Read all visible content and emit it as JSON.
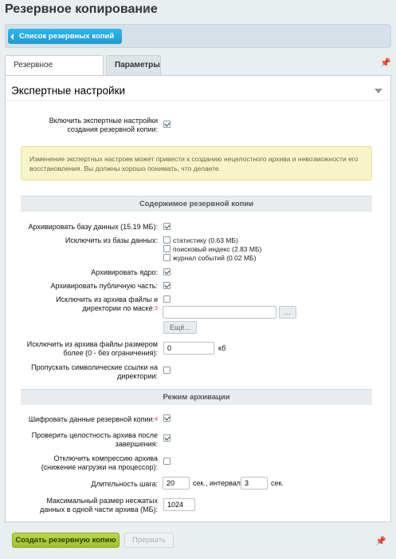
{
  "page": {
    "title": "Резервное копирование",
    "star_icon": "star-icon"
  },
  "toolbar": {
    "list_button": "Список резервных копий"
  },
  "tabs": [
    {
      "label": "Резервное копирование",
      "active": false
    },
    {
      "label": "Параметры",
      "active": true
    }
  ],
  "panel": {
    "title": "Экспертные настройки"
  },
  "expert": {
    "enable_label": "Включить экспертные настройки создания резервной копии:",
    "enable_checked": true,
    "warning": "Изменение экспертных настроек может привести к созданию нецелостного архива и невозможности его восстановления. Вы должны хорошо понимать, что делаете."
  },
  "content_section": {
    "title": "Содержимое резервной копии",
    "archive_db_label": "Архивировать базу данных (15.19 МБ):",
    "archive_db_checked": true,
    "exclude_db_label": "Исключить из базы данных:",
    "exclude_db_options": [
      {
        "label": "статистику (0.63 МБ)",
        "checked": false
      },
      {
        "label": "поисковый индекс (2.83 МБ)",
        "checked": false
      },
      {
        "label": "журнал событий (0.02 МБ)",
        "checked": false
      }
    ],
    "archive_core_label": "Архивировать ядро:",
    "archive_core_checked": true,
    "archive_public_label": "Архивировать публичную часть:",
    "archive_public_checked": true,
    "exclude_mask_label": "Исключить из архива файлы и директории по маске:",
    "exclude_mask_note": "3",
    "exclude_mask_checked": false,
    "mask_value": "",
    "browse_button": "...",
    "more_button": "Ещё...",
    "exclude_size_label": "Исключить из архива файлы размером более (0 - без ограничения):",
    "exclude_size_value": "0",
    "exclude_size_unit": "кб",
    "skip_symlinks_label": "Пропускать символические ссылки на директории:",
    "skip_symlinks_checked": false
  },
  "archive_mode": {
    "title": "Режим архивации",
    "encrypt_label": "Шифровать данные резервной копии:",
    "encrypt_note": "4",
    "encrypt_checked": true,
    "verify_label": "Проверить целостность архива после завершения:",
    "verify_checked": true,
    "no_compress_label": "Отключить компрессию архива (снижение нагрузки на процессор):",
    "no_compress_checked": false,
    "step_label": "Длительность шага:",
    "step_value": "20",
    "step_unit": "сек., интервал:",
    "interval_value": "3",
    "interval_unit": "сек.",
    "max_size_label": "Максимальный размер несжатых данных в одной части архива (МБ):",
    "max_size_value": "1024"
  },
  "footer": {
    "create_button": "Создать резервную копию",
    "stop_button": "Прервать"
  }
}
